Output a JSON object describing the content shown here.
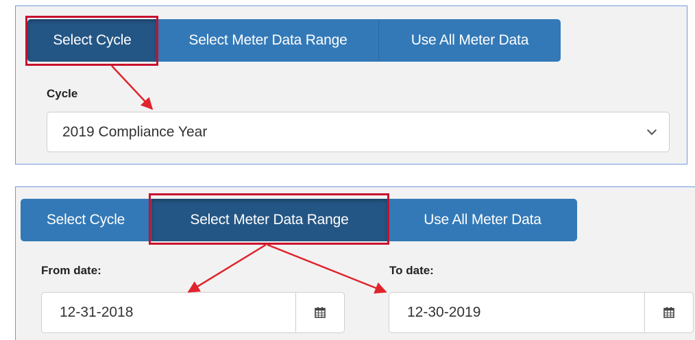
{
  "top_panel": {
    "tabs": [
      {
        "label": "Select Cycle",
        "active": true
      },
      {
        "label": "Select Meter Data Range",
        "active": false
      },
      {
        "label": "Use All Meter Data",
        "active": false
      }
    ],
    "cycle_label": "Cycle",
    "cycle_value": "2019 Compliance Year"
  },
  "bottom_panel": {
    "tabs": [
      {
        "label": "Select Cycle",
        "active": false
      },
      {
        "label": "Select Meter Data Range",
        "active": true
      },
      {
        "label": "Use All Meter Data",
        "active": false
      }
    ],
    "from_label": "From date:",
    "from_value": "12-31-2018",
    "to_label": "To date:",
    "to_value": "12-30-2019"
  },
  "colors": {
    "tab_bg": "#3379b7",
    "tab_active_bg": "#245685",
    "annotation": "#c8102e",
    "panel_border": "#6f9ad8"
  },
  "icons": [
    "chevron-down-icon",
    "calendar-icon",
    "annotation-arrow"
  ]
}
